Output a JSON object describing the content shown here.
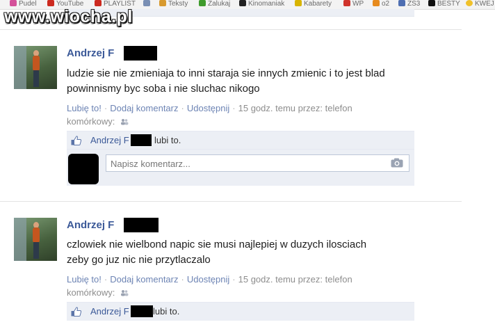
{
  "bookmarks": [
    {
      "label": "Pudel",
      "color": "#d4519a"
    },
    {
      "label": "YouTube",
      "color": "#cc2a1f"
    },
    {
      "label": "PLAYLIST",
      "color": "#cc2a1f"
    },
    {
      "label": "",
      "color": "#7a8fb4"
    },
    {
      "label": "Teksty",
      "color": "#d89a2f"
    },
    {
      "label": "Zalukaj",
      "color": "#3f9b2c"
    },
    {
      "label": "Kinomaniak",
      "color": "#222222"
    },
    {
      "label": "Kabarety",
      "color": "#d8b400"
    },
    {
      "label": "WP",
      "color": "#d0342c"
    },
    {
      "label": "o2",
      "color": "#e78b1e"
    },
    {
      "label": "ZS3",
      "color": "#4f6fb2"
    },
    {
      "label": "BESTY",
      "color": "#111111"
    },
    {
      "label": "KWEJ",
      "color": "#f0c12a"
    }
  ],
  "watermark": "www.wiocha.pl",
  "posts": [
    {
      "author": "Andrzej F",
      "message_line1": "ludzie sie nie zmieniaja to inni staraja sie innych zmienic i to jest blad",
      "message_line2": "powinnismy byc soba i nie sluchac nikogo",
      "like_link": "Lubię to!",
      "comment_link": "Dodaj komentarz",
      "share_link": "Udostępnij",
      "time_text": "15 godz. temu przez: telefon",
      "device_text": "komórkowy:",
      "liker_name": "Andrzej F",
      "liker_suffix": "lubi to.",
      "comment_placeholder": "Napisz komentarz..."
    },
    {
      "author": "Andrzej F",
      "message_line1": "czlowiek nie wielbond napic sie musi najlepiej w duzych ilosciach",
      "message_line2": "zeby go juz nic nie przytlaczalo",
      "like_link": "Lubię to!",
      "comment_link": "Dodaj komentarz",
      "share_link": "Udostępnij",
      "time_text": "15 godz. temu przez: telefon",
      "device_text": "komórkowy:",
      "liker_name": "Andrzej F",
      "liker_suffix": "lubi to."
    }
  ]
}
